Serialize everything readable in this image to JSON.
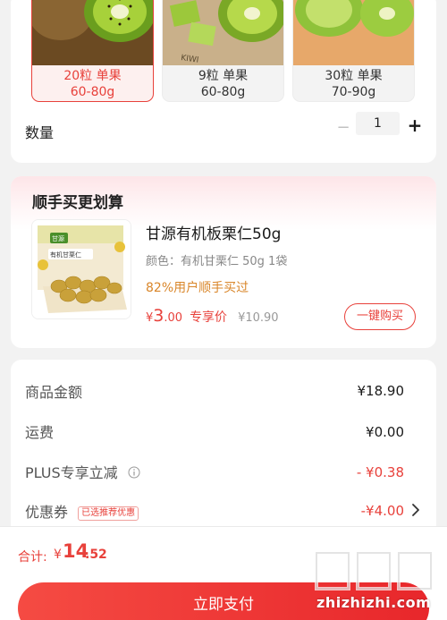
{
  "spec": {
    "options": [
      {
        "line1": "20粒 单果",
        "line2": "60-80g",
        "selected": true
      },
      {
        "line1": "9粒 单果",
        "line2": "60-80g",
        "selected": false
      },
      {
        "line1": "30粒 单果",
        "line2": "70-90g",
        "selected": false
      }
    ],
    "quantity_label": "数量",
    "quantity_minus": "−",
    "quantity_value": "1",
    "quantity_plus": "+"
  },
  "bundle": {
    "title": "顺手买更划算",
    "product_name": "甘源有机板栗仁50g",
    "variant": "颜色：有机甘栗仁 50g 1袋",
    "social_proof": "82%用户顺手买过",
    "price_yen": "¥",
    "price_int": "3",
    "price_dec": ".00",
    "price_tag": "专享价",
    "original_price": "¥10.90",
    "buy_button": "一键购买",
    "package_brand": "甘源",
    "package_text": "有机甘栗仁"
  },
  "summary": {
    "rows": [
      {
        "label": "商品金额",
        "value": "¥18.90"
      },
      {
        "label": "运费",
        "value": "¥0.00"
      },
      {
        "label": "PLUS专享立减",
        "value": "- ¥0.38"
      },
      {
        "label": "优惠券",
        "value": "-¥4.00",
        "tag": "已选推荐优惠"
      }
    ]
  },
  "footer": {
    "total_label": "合计:",
    "total_yen": "¥",
    "total_int": "14",
    "total_dec": ".52",
    "pay_button": "立即支付"
  },
  "watermark": {
    "text": "zhizhizhi.com"
  },
  "colors": {
    "accent": "#e8413b",
    "social_proof": "#d9862a",
    "muted": "#999999"
  }
}
